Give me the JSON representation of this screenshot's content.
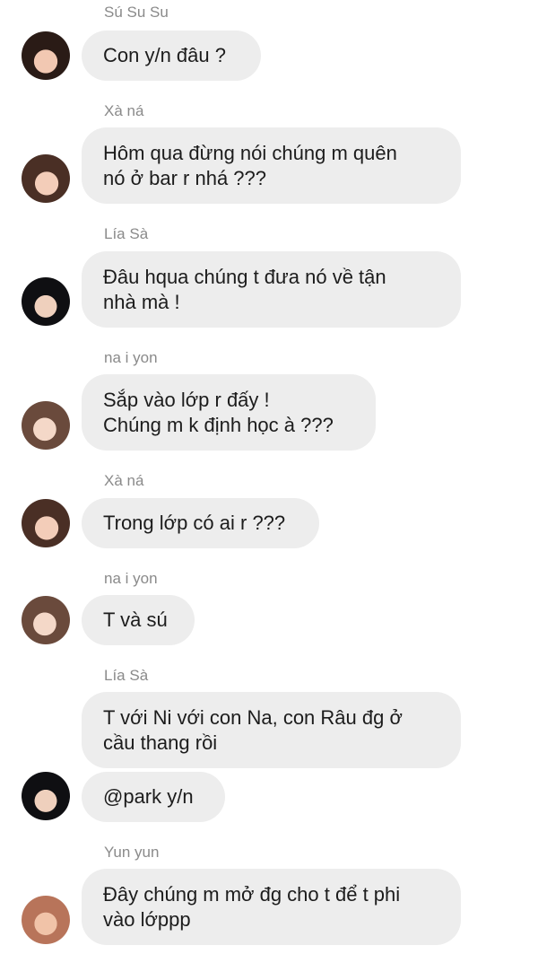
{
  "messages": [
    {
      "sender": "Sú Su Su",
      "lines": [
        "Con y/n đâu ?"
      ]
    },
    {
      "sender": "Xà ná",
      "lines": [
        "Hôm qua đừng nói chúng m quên",
        "nó ở bar r nhá ???"
      ]
    },
    {
      "sender": "Lía Sà",
      "lines": [
        "Đâu hqua chúng t đưa nó về tận",
        "nhà mà !"
      ]
    },
    {
      "sender": "na i yon",
      "lines": [
        "Sắp vào lớp r đấy !",
        "Chúng m k định học à ???"
      ]
    },
    {
      "sender": "Xà ná",
      "lines": [
        "Trong lớp có ai r ???"
      ]
    },
    {
      "sender": "na i yon",
      "lines": [
        "T và sú"
      ]
    },
    {
      "sender": "Lía Sà",
      "lines": [
        "T với Ni với con Na, con Râu đg ở",
        "cầu thang rồi"
      ]
    },
    {
      "sender": "",
      "lines": [
        "@park y/n"
      ]
    },
    {
      "sender": "Yun yun",
      "lines": [
        "Đây chúng m mở đg cho t để t phi",
        "vào lớppp"
      ]
    }
  ],
  "colors": {
    "bubble": "#ededed",
    "sender": "#8a8a8a",
    "text": "#1c1c1c"
  }
}
